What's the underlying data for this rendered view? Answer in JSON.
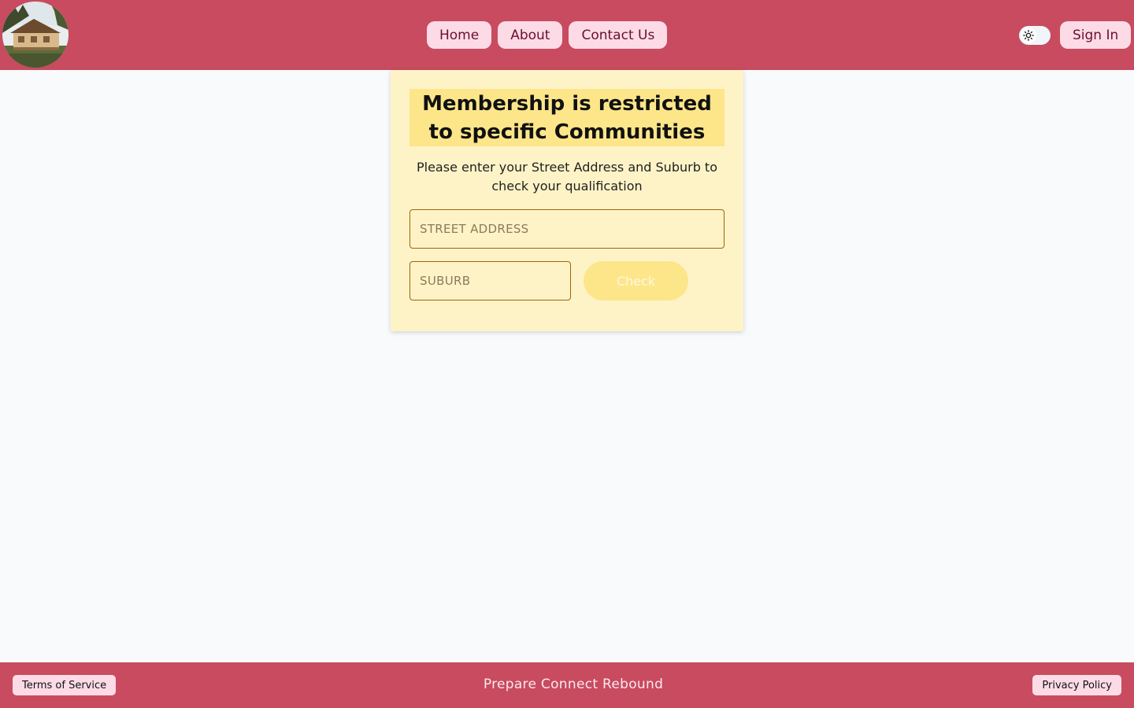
{
  "header": {
    "nav": [
      {
        "label": "Home"
      },
      {
        "label": "About"
      },
      {
        "label": "Contact Us"
      }
    ],
    "sign_in_label": "Sign In",
    "theme_icon": "sun-icon"
  },
  "card": {
    "title": "Membership is restricted to specific Communities",
    "subtitle": "Please enter your Street Address and Suburb to check your qualification",
    "street_placeholder": "STREET ADDRESS",
    "suburb_placeholder": "SUBURB",
    "check_label": "Check"
  },
  "footer": {
    "terms_label": "Terms of Service",
    "tagline": "Prepare Connect Rebound",
    "privacy_label": "Privacy Policy"
  },
  "colors": {
    "brand": "#c84b5f",
    "button_bg": "#fcdbe7",
    "card_bg": "#fef3c7",
    "title_bg": "#fde68a",
    "page_bg": "#f8fafc"
  }
}
